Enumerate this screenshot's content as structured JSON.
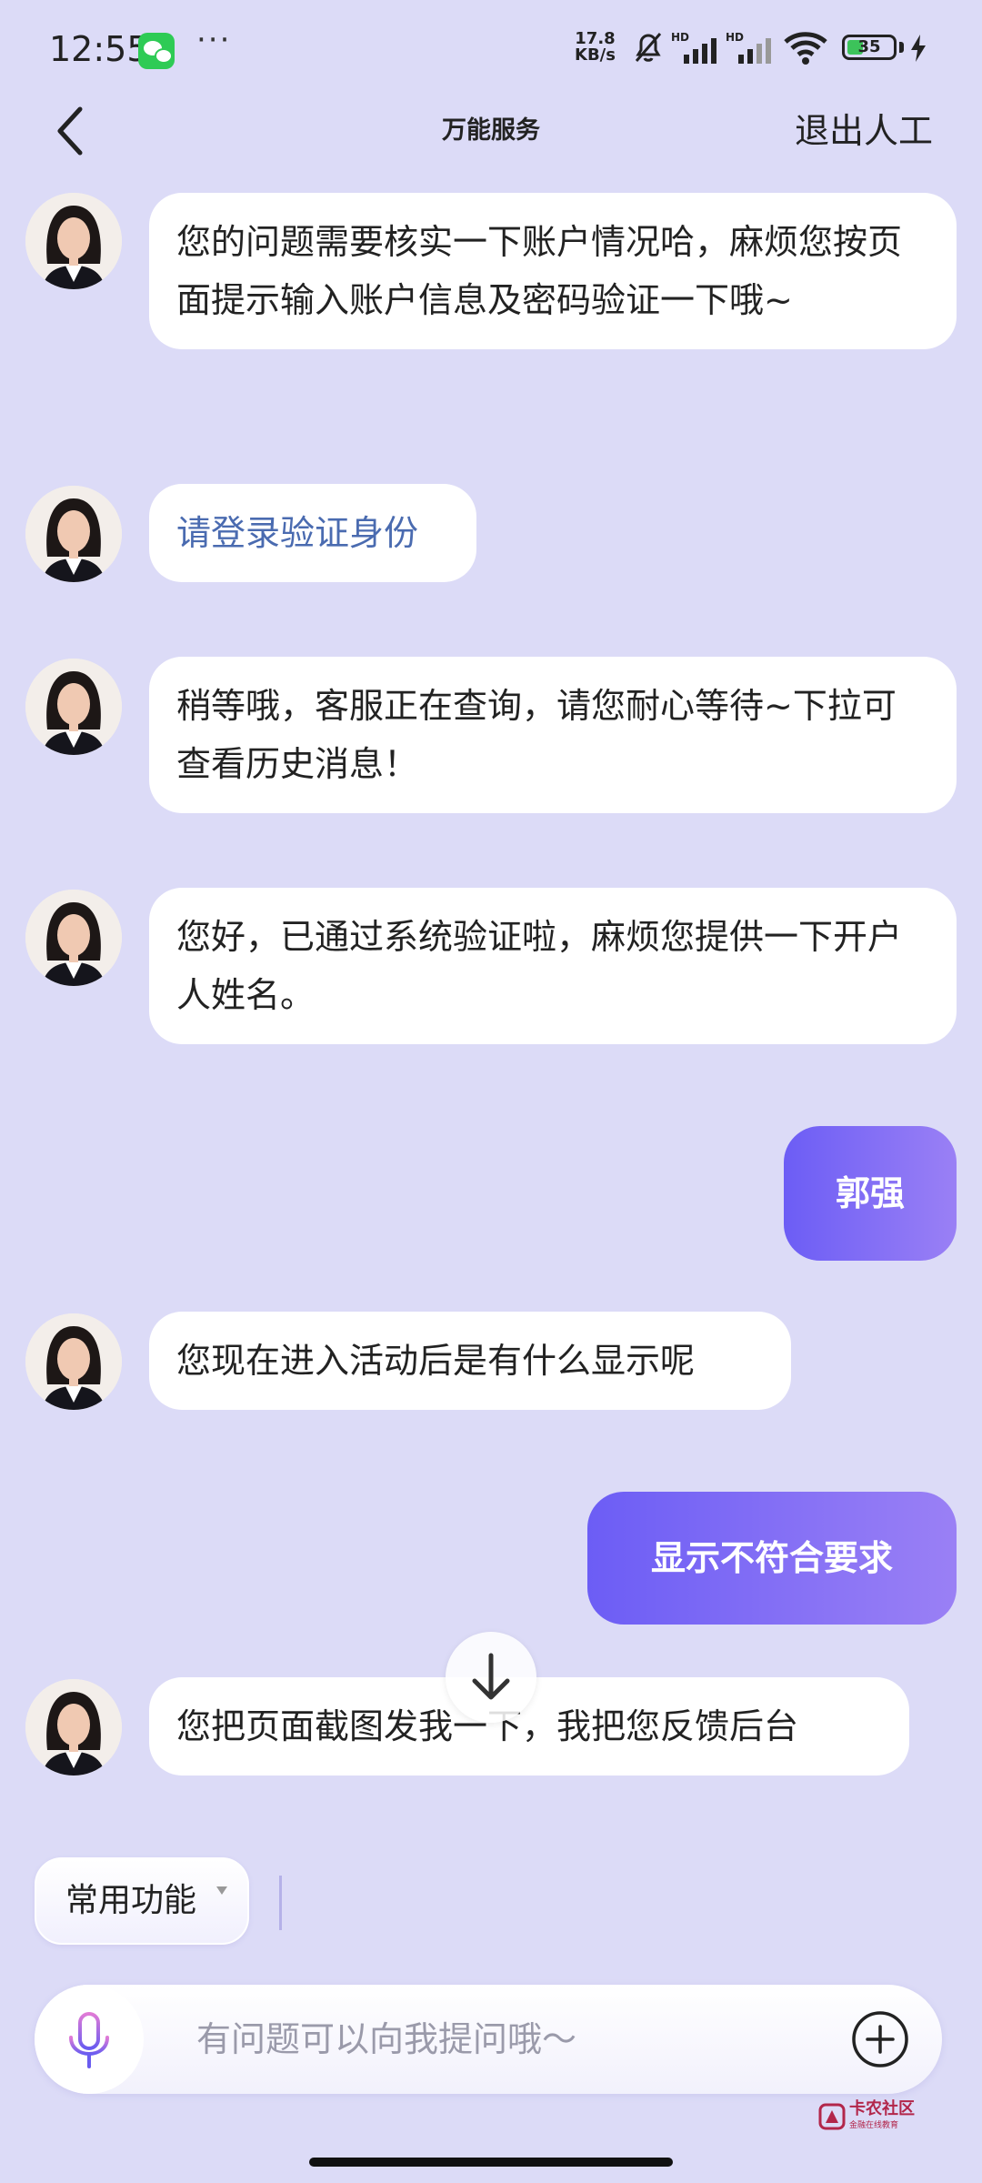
{
  "status_bar": {
    "time": "12:55",
    "more": "···",
    "net_speed_value": "17.8",
    "net_speed_unit": "KB/s",
    "signal1_label": "HD",
    "signal2_label": "HD",
    "battery_level": "35",
    "battery_fraction": 0.35
  },
  "header": {
    "title": "万能服务",
    "exit_label": "退出人工"
  },
  "messages": [
    {
      "from": "agent",
      "text": "您的问题需要核实一下账户情况哈，麻烦您按页面提示输入账户信息及密码验证一下哦~"
    },
    {
      "from": "agent",
      "text": "请登录验证身份",
      "style": "link"
    },
    {
      "from": "agent",
      "text": "稍等哦，客服正在查询，请您耐心等待~下拉可查看历史消息！"
    },
    {
      "from": "agent",
      "text": "您好，已通过系统验证啦，麻烦您提供一下开户人姓名。"
    },
    {
      "from": "user",
      "text": "郭强"
    },
    {
      "from": "agent",
      "text": "您现在进入活动后是有什么显示呢"
    },
    {
      "from": "user",
      "text": "显示不符合要求"
    },
    {
      "from": "agent",
      "text": "您把页面截图发我一下，我把您反馈后台"
    }
  ],
  "toolbar": {
    "common_functions_label": "常用功能"
  },
  "input": {
    "placeholder": "有问题可以向我提问哦～"
  },
  "watermark": {
    "title": "卡农社区",
    "subtitle": "金融在线教育"
  },
  "colors": {
    "background": "#dcdbf7",
    "user_bubble_start": "#6c5df5",
    "user_bubble_end": "#9a80f5",
    "link_text": "#4a6bb0"
  },
  "icons": {
    "back": "back-arrow-icon",
    "scroll": "arrow-down-icon",
    "mic": "microphone-icon",
    "plus": "plus-circle-icon"
  }
}
